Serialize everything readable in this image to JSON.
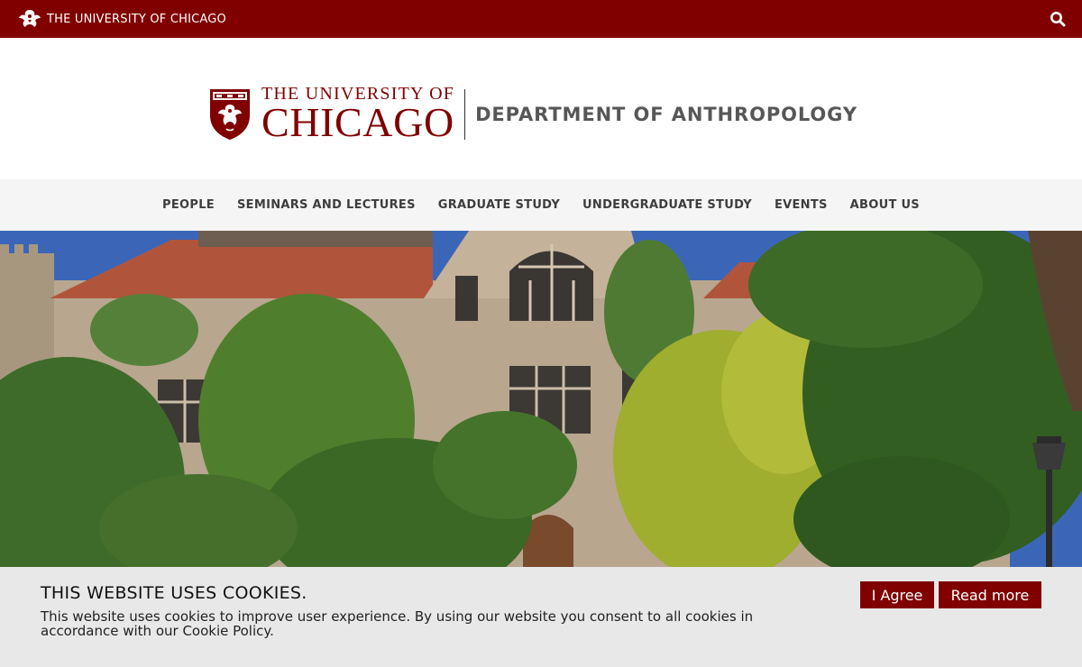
{
  "topbar": {
    "brand": "THE UNIVERSITY OF CHICAGO",
    "search_icon": "search-icon",
    "color": "#800000"
  },
  "logo": {
    "line1": "THE UNIVERSITY OF",
    "line2": "CHICAGO",
    "department": "DEPARTMENT OF ANTHROPOLOGY"
  },
  "nav": {
    "items": [
      {
        "label": "PEOPLE"
      },
      {
        "label": "SEMINARS AND LECTURES"
      },
      {
        "label": "GRADUATE STUDY"
      },
      {
        "label": "UNDERGRADUATE STUDY"
      },
      {
        "label": "EVENTS"
      },
      {
        "label": "ABOUT US"
      }
    ]
  },
  "cookie": {
    "title": "THIS WEBSITE USES COOKIES.",
    "text": "This website uses cookies to improve user experience. By using our website you consent to all cookies in accordance with our Cookie Policy.",
    "agree_label": "I Agree",
    "read_more_label": "Read more"
  }
}
